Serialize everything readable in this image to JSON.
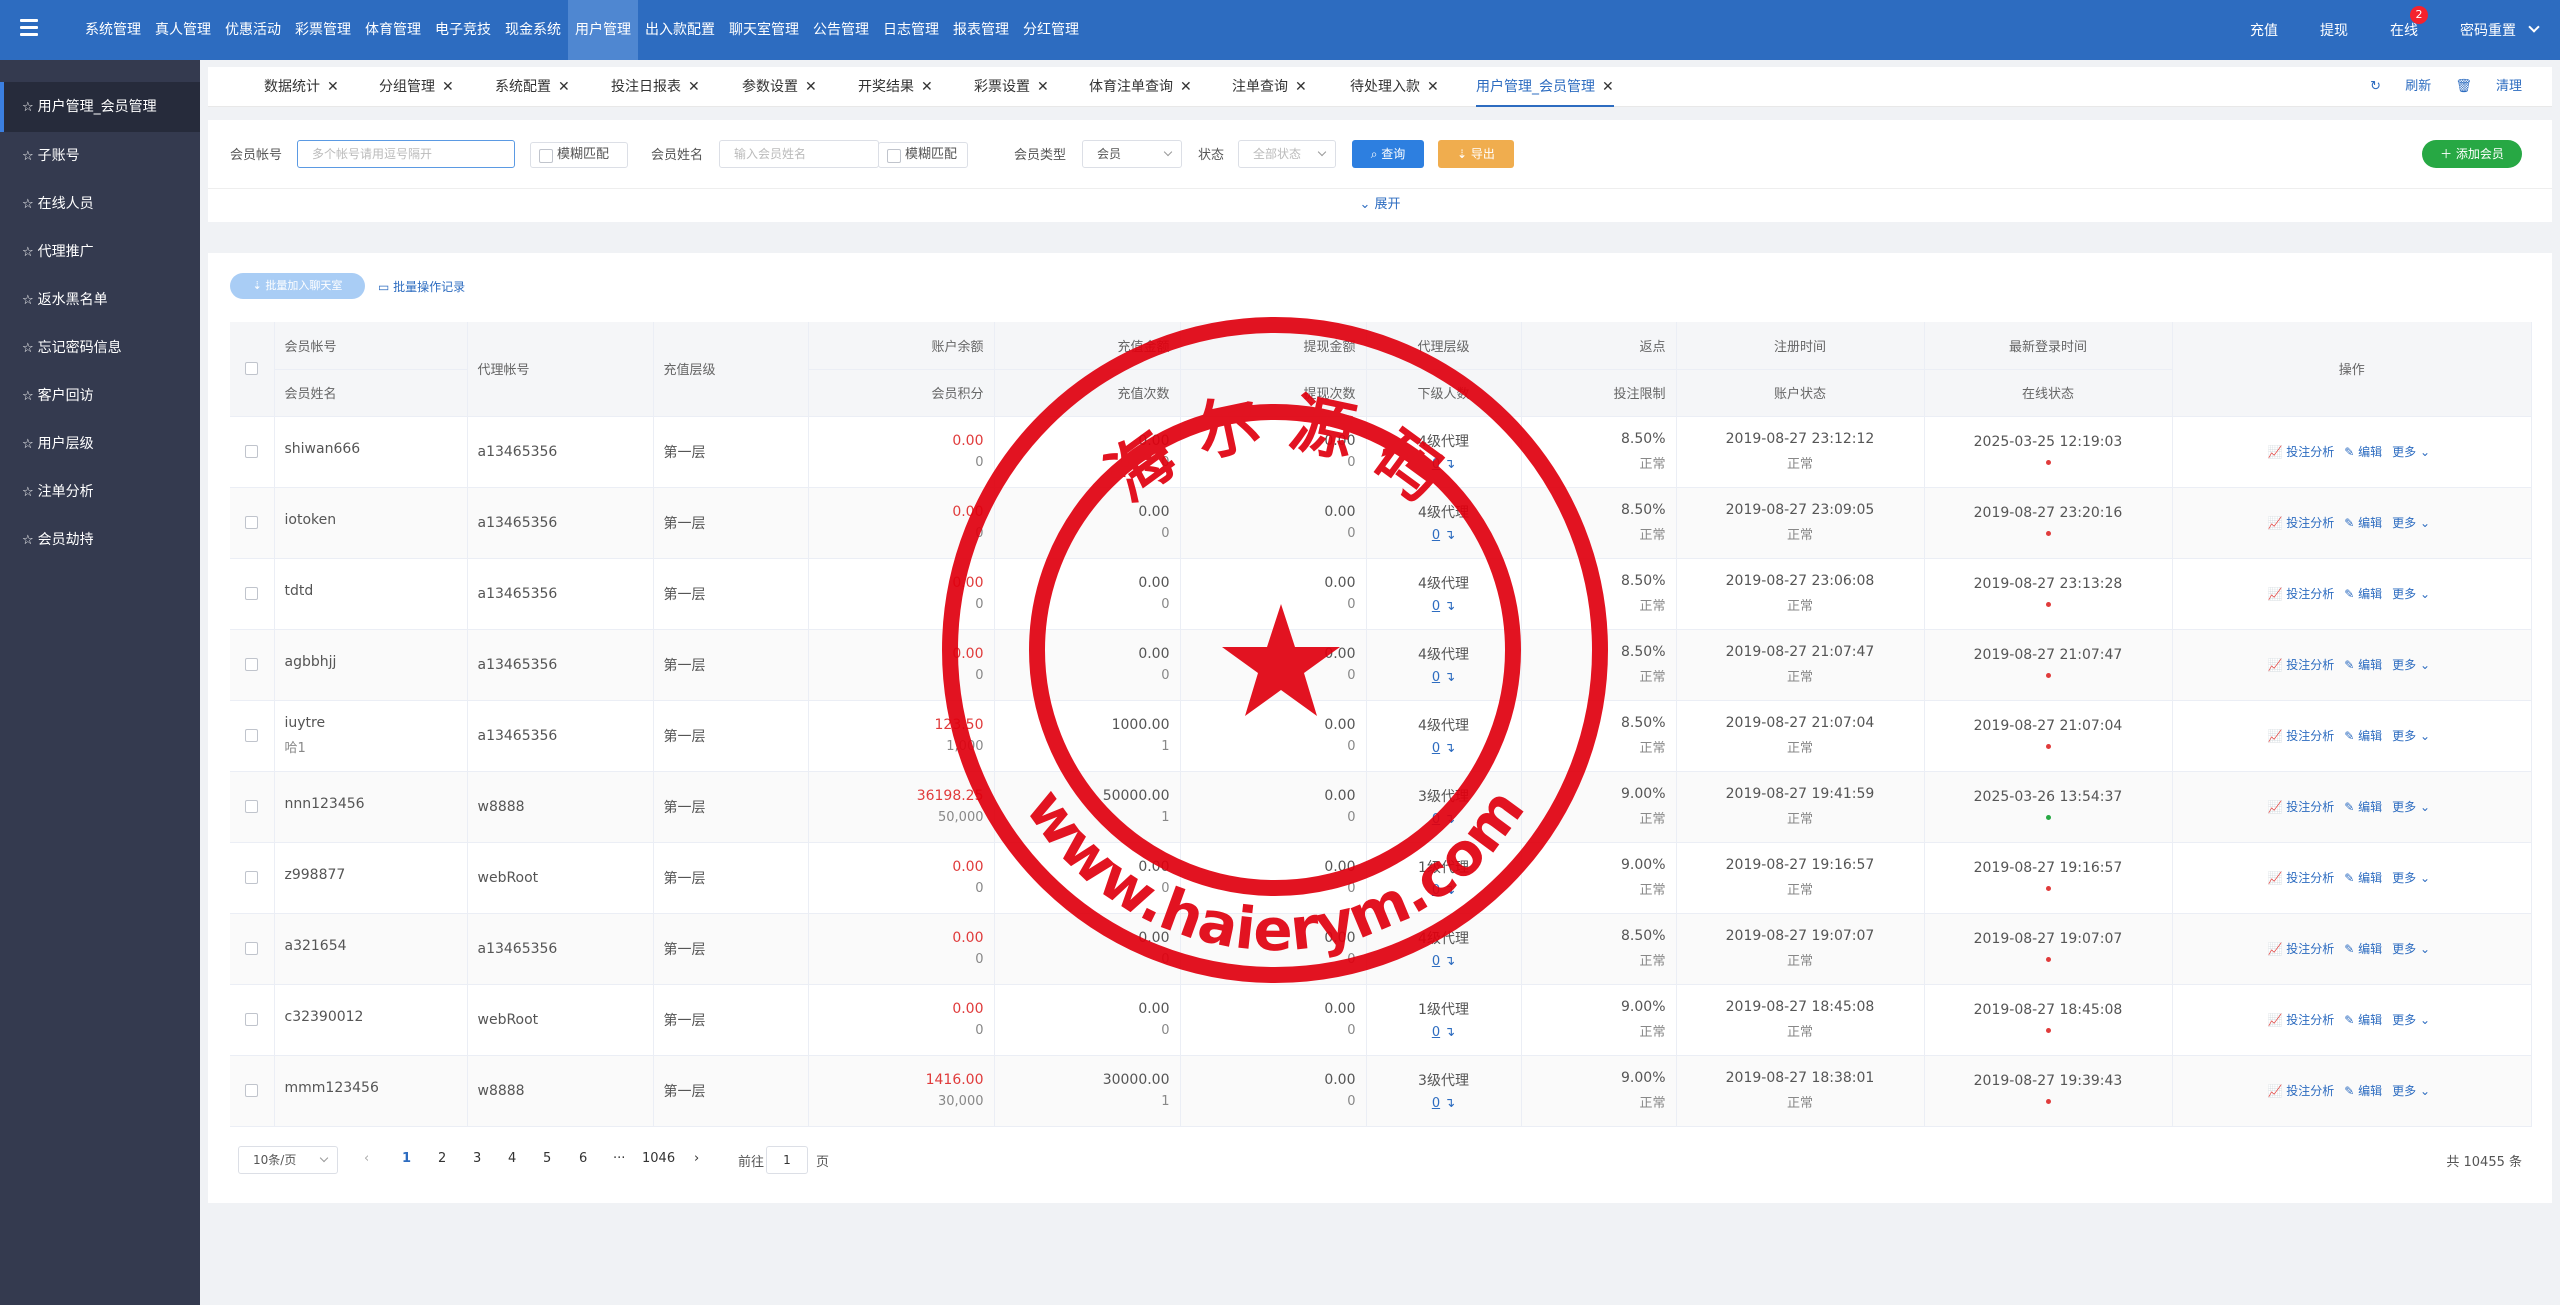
{
  "topnav": [
    "系统管理",
    "真人管理",
    "优惠活动",
    "彩票管理",
    "体育管理",
    "电子竞技",
    "现金系统",
    "用户管理",
    "出入款配置",
    "聊天室管理",
    "公告管理",
    "日志管理",
    "报表管理",
    "分红管理"
  ],
  "topright": {
    "recharge": "充值",
    "withdraw": "提现",
    "online": "在线",
    "online_badge": "2",
    "pwd_reset": "密码重置"
  },
  "sidebar": [
    "用户管理_会员管理",
    "子账号",
    "在线人员",
    "代理推广",
    "返水黑名单",
    "忘记密码信息",
    "客户回访",
    "用户层级",
    "注单分析",
    "会员劫持"
  ],
  "tabs": [
    "数据统计",
    "分组管理",
    "系统配置",
    "投注日报表",
    "参数设置",
    "开奖结果",
    "彩票设置",
    "体育注单查询",
    "注单查询",
    "待处理入款",
    "用户管理_会员管理"
  ],
  "tabtools": {
    "refresh": "刷新",
    "clear": "清理"
  },
  "filter": {
    "account_label": "会员帐号",
    "account_placeholder": "多个帐号请用逗号隔开",
    "fuzzy1": "模糊匹配",
    "name_label": "会员姓名",
    "name_placeholder": "输入会员姓名",
    "fuzzy2": "模糊匹配",
    "type_label": "会员类型",
    "type_value": "会员",
    "status_label": "状态",
    "status_placeholder": "全部状态",
    "search": "查询",
    "export": "导出",
    "add": "添加会员",
    "expand": "展开"
  },
  "actions": {
    "batch_chat": "批量加入聊天室",
    "batch_log": "批量操作记录"
  },
  "columns": {
    "account": "会员帐号",
    "name": "会员姓名",
    "agent": "代理帐号",
    "level": "充值层级",
    "balance": "账户余额",
    "points": "会员积分",
    "recharge_amt": "充值金额",
    "recharge_cnt": "充值次数",
    "withdraw_amt": "提现金额",
    "withdraw_cnt": "提现次数",
    "agent_level": "代理层级",
    "sub_count": "下级人数",
    "rebate": "返点",
    "bet_limit": "投注限制",
    "reg_time": "注册时间",
    "acct_status": "账户状态",
    "last_login": "最新登录时间",
    "online_status": "在线状态",
    "ops": "操作"
  },
  "rows": [
    {
      "account": "shiwan666",
      "name": "",
      "agent": "a13465356",
      "level": "第一层",
      "balance": "0.00",
      "points": "0",
      "recharge": "0.00",
      "rcnt": "0",
      "withdraw": "0.00",
      "wcnt": "0",
      "alevel": "4级代理",
      "sub": "0",
      "rebate": "8.50%",
      "limit": "正常",
      "reg": "2019-08-27 23:12:12",
      "astatus": "正常",
      "login": "2025-03-25 12:19:03",
      "online": "red"
    },
    {
      "account": "iotoken",
      "name": "",
      "agent": "a13465356",
      "level": "第一层",
      "balance": "0.00",
      "points": "0",
      "recharge": "0.00",
      "rcnt": "0",
      "withdraw": "0.00",
      "wcnt": "0",
      "alevel": "4级代理",
      "sub": "0",
      "rebate": "8.50%",
      "limit": "正常",
      "reg": "2019-08-27 23:09:05",
      "astatus": "正常",
      "login": "2019-08-27 23:20:16",
      "online": "red"
    },
    {
      "account": "tdtd",
      "name": "",
      "agent": "a13465356",
      "level": "第一层",
      "balance": "0.00",
      "points": "0",
      "recharge": "0.00",
      "rcnt": "0",
      "withdraw": "0.00",
      "wcnt": "0",
      "alevel": "4级代理",
      "sub": "0",
      "rebate": "8.50%",
      "limit": "正常",
      "reg": "2019-08-27 23:06:08",
      "astatus": "正常",
      "login": "2019-08-27 23:13:28",
      "online": "red"
    },
    {
      "account": "agbbhjj",
      "name": "",
      "agent": "a13465356",
      "level": "第一层",
      "balance": "0.00",
      "points": "0",
      "recharge": "0.00",
      "rcnt": "0",
      "withdraw": "0.00",
      "wcnt": "0",
      "alevel": "4级代理",
      "sub": "0",
      "rebate": "8.50%",
      "limit": "正常",
      "reg": "2019-08-27 21:07:47",
      "astatus": "正常",
      "login": "2019-08-27 21:07:47",
      "online": "red"
    },
    {
      "account": "iuytre",
      "name": "哈1",
      "agent": "a13465356",
      "level": "第一层",
      "balance": "123.50",
      "points": "1,000",
      "recharge": "1000.00",
      "rcnt": "1",
      "withdraw": "0.00",
      "wcnt": "0",
      "alevel": "4级代理",
      "sub": "0",
      "rebate": "8.50%",
      "limit": "正常",
      "reg": "2019-08-27 21:07:04",
      "astatus": "正常",
      "login": "2019-08-27 21:07:04",
      "online": "red"
    },
    {
      "account": "nnn123456",
      "name": "",
      "agent": "w8888",
      "level": "第一层",
      "balance": "36198.25",
      "points": "50,000",
      "recharge": "50000.00",
      "rcnt": "1",
      "withdraw": "0.00",
      "wcnt": "0",
      "alevel": "3级代理",
      "sub": "0",
      "rebate": "9.00%",
      "limit": "正常",
      "reg": "2019-08-27 19:41:59",
      "astatus": "正常",
      "login": "2025-03-26 13:54:37",
      "online": "green"
    },
    {
      "account": "z998877",
      "name": "",
      "agent": "webRoot",
      "level": "第一层",
      "balance": "0.00",
      "points": "0",
      "recharge": "0.00",
      "rcnt": "0",
      "withdraw": "0.00",
      "wcnt": "0",
      "alevel": "1级代理",
      "sub": "0",
      "rebate": "9.00%",
      "limit": "正常",
      "reg": "2019-08-27 19:16:57",
      "astatus": "正常",
      "login": "2019-08-27 19:16:57",
      "online": "red"
    },
    {
      "account": "a321654",
      "name": "",
      "agent": "a13465356",
      "level": "第一层",
      "balance": "0.00",
      "points": "0",
      "recharge": "0.00",
      "rcnt": "0",
      "withdraw": "0.00",
      "wcnt": "0",
      "alevel": "4级代理",
      "sub": "0",
      "rebate": "8.50%",
      "limit": "正常",
      "reg": "2019-08-27 19:07:07",
      "astatus": "正常",
      "login": "2019-08-27 19:07:07",
      "online": "red"
    },
    {
      "account": "c32390012",
      "name": "",
      "agent": "webRoot",
      "level": "第一层",
      "balance": "0.00",
      "points": "0",
      "recharge": "0.00",
      "rcnt": "0",
      "withdraw": "0.00",
      "wcnt": "0",
      "alevel": "1级代理",
      "sub": "0",
      "rebate": "9.00%",
      "limit": "正常",
      "reg": "2019-08-27 18:45:08",
      "astatus": "正常",
      "login": "2019-08-27 18:45:08",
      "online": "red"
    },
    {
      "account": "mmm123456",
      "name": "",
      "agent": "w8888",
      "level": "第一层",
      "balance": "1416.00",
      "points": "30,000",
      "recharge": "30000.00",
      "rcnt": "1",
      "withdraw": "0.00",
      "wcnt": "0",
      "alevel": "3级代理",
      "sub": "0",
      "rebate": "9.00%",
      "limit": "正常",
      "reg": "2019-08-27 18:38:01",
      "astatus": "正常",
      "login": "2019-08-27 19:39:43",
      "online": "red"
    }
  ],
  "row_ops": {
    "analysis": "投注分析",
    "edit": "编辑",
    "more": "更多"
  },
  "pager": {
    "size": "10条/页",
    "pages": [
      "1",
      "2",
      "3",
      "4",
      "5",
      "6"
    ],
    "ellipsis": "···",
    "last": "1046",
    "goto": "前往",
    "page_input": "1",
    "page_unit": "页",
    "total": "共 10455 条"
  },
  "stamp": {
    "top_text": "海 尔 源 码",
    "bottom_text": "www.haierym.com"
  },
  "colors": {
    "primary": "#2d6cc0",
    "sidebar": "#343a4f",
    "stamp": "#e0000f",
    "orange": "#f0ad4e",
    "green": "#27a844"
  }
}
